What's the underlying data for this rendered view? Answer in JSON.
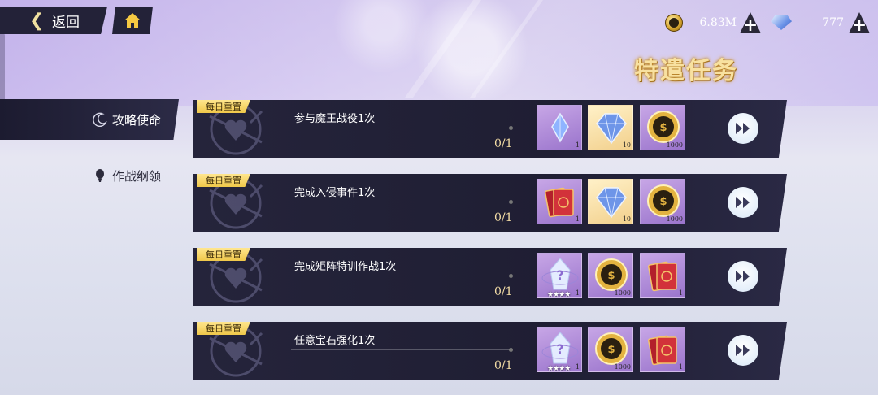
{
  "header": {
    "back_label": "返回",
    "icons": {
      "back": "chevron-left-icon",
      "home": "home-icon"
    },
    "gold": {
      "icon": "gold-coin-icon",
      "value": "6.83M"
    },
    "gems": {
      "icon": "blue-gem-icon",
      "value": "777"
    }
  },
  "page_title": "特遣任务",
  "sidebar": {
    "items": [
      {
        "label": "攻略使命",
        "icon": "crescent-moon-icon",
        "active": true
      },
      {
        "label": "作战纲领",
        "icon": "balloon-icon",
        "active": false
      }
    ]
  },
  "tasks": [
    {
      "tag": "每日重置",
      "name": "参与魔王战役1次",
      "progress": "0/1",
      "rewards": [
        {
          "icon": "blue-crystal-icon",
          "count": "1",
          "bg": "purple"
        },
        {
          "icon": "large-gem-icon",
          "count": "10",
          "bg": "gold"
        },
        {
          "icon": "gold-coin-icon",
          "count": "1000",
          "bg": "purple"
        }
      ]
    },
    {
      "tag": "每日重置",
      "name": "完成入侵事件1次",
      "progress": "0/1",
      "rewards": [
        {
          "icon": "red-card-pack-icon",
          "count": "1",
          "bg": "purple"
        },
        {
          "icon": "large-gem-icon",
          "count": "10",
          "bg": "gold"
        },
        {
          "icon": "gold-coin-icon",
          "count": "1000",
          "bg": "purple"
        }
      ]
    },
    {
      "tag": "每日重置",
      "name": "完成矩阵特训作战1次",
      "progress": "0/1",
      "rewards": [
        {
          "icon": "mystery-crystal-icon",
          "count": "1",
          "bg": "purple",
          "stars": "★★★★"
        },
        {
          "icon": "gold-coin-icon",
          "count": "1000",
          "bg": "purple"
        },
        {
          "icon": "red-card-pack-icon",
          "count": "1",
          "bg": "purple"
        }
      ]
    },
    {
      "tag": "每日重置",
      "name": "任意宝石强化1次",
      "progress": "0/1",
      "rewards": [
        {
          "icon": "mystery-crystal-icon",
          "count": "1",
          "bg": "purple",
          "stars": "★★★★"
        },
        {
          "icon": "gold-coin-icon",
          "count": "1000",
          "bg": "purple"
        },
        {
          "icon": "red-card-pack-icon",
          "count": "1",
          "bg": "purple"
        }
      ]
    }
  ]
}
